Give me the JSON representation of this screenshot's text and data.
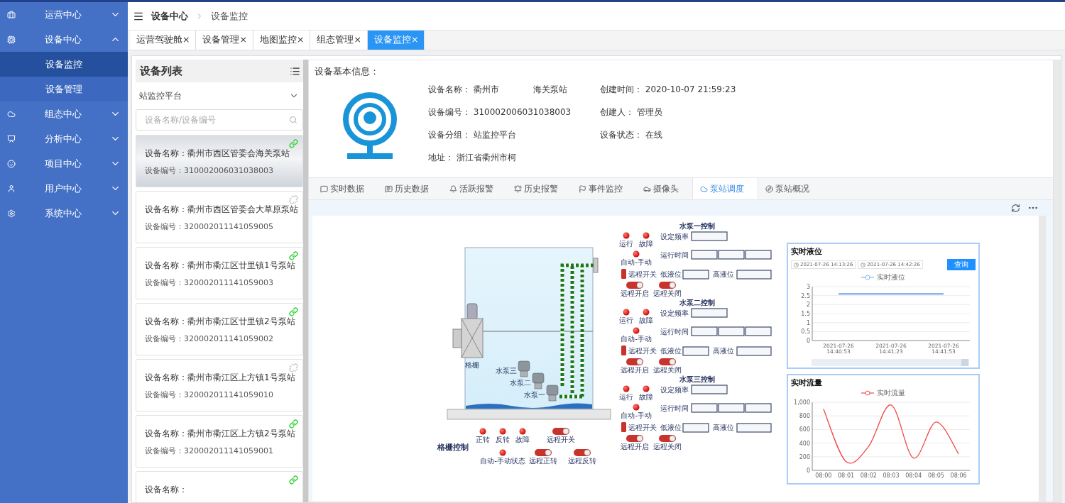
{
  "sidebar": {
    "items": [
      {
        "label": "运营中心",
        "expanded": false
      },
      {
        "label": "设备中心",
        "expanded": true,
        "children": [
          {
            "label": "设备监控",
            "selected": true
          },
          {
            "label": "设备管理",
            "selected": false
          }
        ]
      },
      {
        "label": "组态中心",
        "expanded": false
      },
      {
        "label": "分析中心",
        "expanded": false
      },
      {
        "label": "项目中心",
        "expanded": false
      },
      {
        "label": "用户中心",
        "expanded": false
      },
      {
        "label": "系统中心",
        "expanded": false
      }
    ]
  },
  "breadcrumb": [
    "设备中心",
    "设备监控"
  ],
  "page_tabs": [
    {
      "label": "运营驾驶舱",
      "close": "×",
      "selected": false
    },
    {
      "label": "设备管理",
      "close": "×",
      "selected": false
    },
    {
      "label": "地图监控",
      "close": "×",
      "selected": false
    },
    {
      "label": "组态管理",
      "close": "×",
      "selected": false
    },
    {
      "label": "设备监控",
      "close": "×",
      "selected": true
    }
  ],
  "device_list": {
    "title": "设备列表",
    "group": "站监控平台",
    "search": {
      "placeholder": "设备名称/设备编号"
    },
    "devices": [
      {
        "name": "设备名称：衢州市西区管委会海关泵站",
        "code": "设备编号：310002006031038003",
        "connected": true,
        "selected": true
      },
      {
        "name": "设备名称：衢州市西区管委会大草原泵站",
        "code": "设备编号：320002011141059005",
        "connected": false,
        "selected": false
      },
      {
        "name": "设备名称：衢州市衢江区廿里镇1号泵站",
        "code": "设备编号：320002011141059003",
        "connected": true,
        "selected": false
      },
      {
        "name": "设备名称：衢州市衢江区廿里镇2号泵站",
        "code": "设备编号：320002011141059002",
        "connected": true,
        "selected": false
      },
      {
        "name": "设备名称：衢州市衢江区上方镇1号泵站",
        "code": "设备编号：320002011141059010",
        "connected": false,
        "selected": false
      },
      {
        "name": "设备名称：衢州市衢江区上方镇2号泵站",
        "code": "设备编号：320002011141059001",
        "connected": true,
        "selected": false
      },
      {
        "name": "设备名称：",
        "connected": true,
        "selected": false
      }
    ]
  },
  "info": {
    "title": "设备基本信息：",
    "fields": [
      {
        "label": "设备名称：",
        "value": "衢州市　　　　海关泵站"
      },
      {
        "label": "创建时间：",
        "value": "2020-10-07 21:59:23"
      },
      {
        "label": "设备编号：",
        "value": "310002006031038003"
      },
      {
        "label": "创建人：",
        "value": "管理员"
      },
      {
        "label": "设备分组：",
        "value": "站监控平台"
      },
      {
        "label": "设备状态：",
        "value": "在线"
      },
      {
        "label": "地址：",
        "value": "浙江省衢州市柯"
      }
    ]
  },
  "detail_tabs": [
    {
      "label": "实时数据",
      "selected": false
    },
    {
      "label": "历史数据",
      "selected": false
    },
    {
      "label": "活跃报警",
      "selected": false
    },
    {
      "label": "历史报警",
      "selected": false
    },
    {
      "label": "事件监控",
      "selected": false
    },
    {
      "label": "摄像头",
      "selected": false
    },
    {
      "label": "泵站调度",
      "selected": true
    },
    {
      "label": "泵站概况",
      "selected": false
    }
  ],
  "diagram": {
    "screen_label": "格栅",
    "pump_labels": [
      "水泵三",
      "水泵二",
      "水泵一"
    ],
    "pump_panels": [
      {
        "title": "水泵一控制",
        "run": "运行",
        "fault": "故障",
        "mode": "自动-手动",
        "freq": "设定频率",
        "runtime": "运行时间",
        "remote": "远程开关",
        "low": "低液位",
        "high": "高液位",
        "toggles": [
          {
            "label": "远程开启",
            "on": false
          },
          {
            "label": "远程关闭",
            "on": false
          }
        ]
      },
      {
        "title": "水泵二控制",
        "run": "运行",
        "fault": "故障",
        "mode": "自动-手动",
        "freq": "设定频率",
        "runtime": "运行时间",
        "remote": "远程开关",
        "low": "低液位",
        "high": "高液位",
        "toggles": [
          {
            "label": "远程开启",
            "on": false
          },
          {
            "label": "远程关闭",
            "on": false
          }
        ]
      },
      {
        "title": "水泵三控制",
        "run": "运行",
        "fault": "故障",
        "mode": "自动-手动",
        "freq": "设定频率",
        "runtime": "运行时间",
        "remote": "远程开关",
        "low": "低液位",
        "high": "高液位",
        "toggles": [
          {
            "label": "远程开启",
            "on": false
          },
          {
            "label": "远程关闭",
            "on": false
          }
        ]
      }
    ],
    "screen_panel": {
      "title": "格栅控制",
      "lights": [
        "正转",
        "反转",
        "故障"
      ],
      "mode": "自动-手动状态",
      "switches": [
        {
          "label": "远程开关",
          "on": false
        },
        {
          "label": "远程正转",
          "on": false
        },
        {
          "label": "远程反转",
          "on": false
        }
      ]
    }
  },
  "charts": [
    {
      "title": "实时液位",
      "range": {
        "start": "2021-07-26 14:13:26",
        "end": "2021-07-26 14:42:26"
      },
      "query": "查询",
      "zoom": {
        "level": 1
      },
      "chart_data": {
        "type": "line",
        "categories": [
          "2021-07-26 14:40:53",
          "2021-07-26 14:41:23",
          "2021-07-26 14:41:53"
        ],
        "series": [
          {
            "name": "实时液位",
            "color": "#8ab4f0",
            "values": [
              2.6,
              2.6,
              2.6
            ]
          }
        ],
        "ylim": [
          0,
          3
        ],
        "yticks": [
          0,
          0.5,
          1,
          1.5,
          2,
          2.5,
          3
        ],
        "grid": true
      }
    },
    {
      "title": "实时流量",
      "chart_data": {
        "type": "line",
        "categories": [
          "08:00",
          "08:01",
          "08:02",
          "08:03",
          "08:04",
          "08:05",
          "08:06"
        ],
        "series": [
          {
            "name": "实时流量",
            "color": "#f04848",
            "values": [
              900,
              130,
              350,
              960,
              180,
              710,
              240
            ]
          }
        ],
        "ylim": [
          0,
          1000
        ],
        "yticks": [
          0,
          200,
          400,
          600,
          800,
          {
            "value": 1000,
            "label": "1,000"
          }
        ],
        "grid": true
      }
    }
  ]
}
